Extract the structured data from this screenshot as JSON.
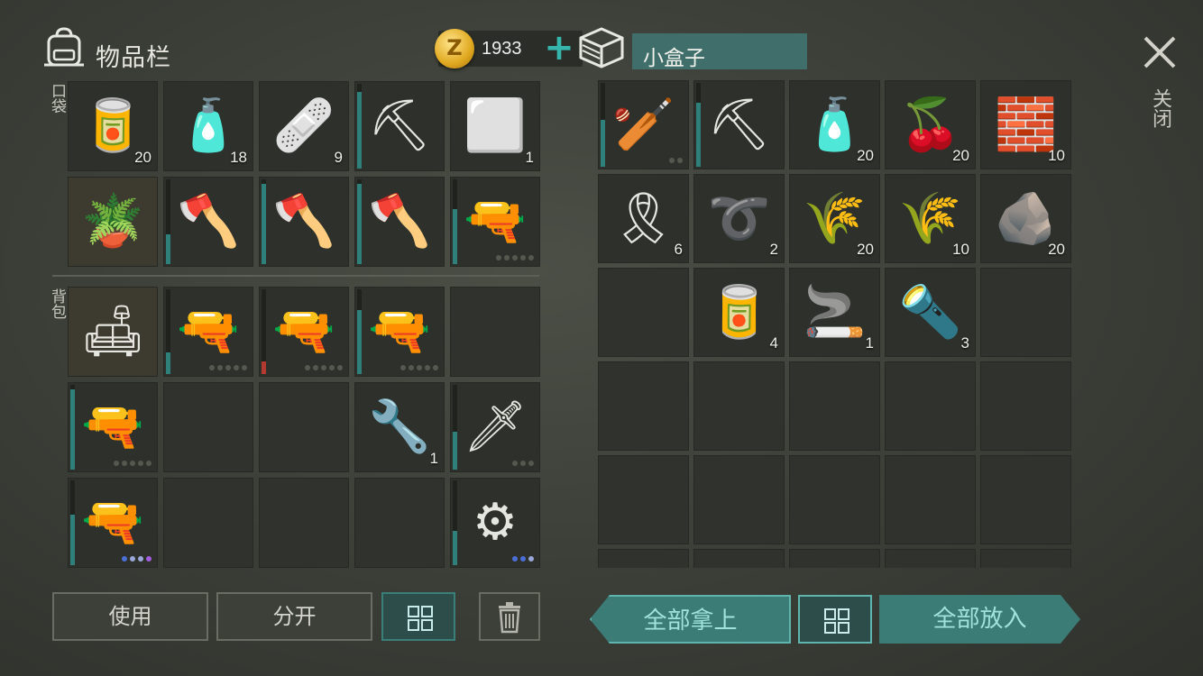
{
  "inventory": {
    "title": "物品栏",
    "coins": "1933",
    "add_symbol": "+",
    "pocket_label": "口袋",
    "backpack_label": "背包",
    "pocket": [
      {
        "icon": "canned-food-icon",
        "glyph": "🥫",
        "qty": "20"
      },
      {
        "icon": "water-bottle-icon",
        "glyph": "🧴",
        "qty": "18"
      },
      {
        "icon": "bandage-icon",
        "glyph": "🩹",
        "qty": "9"
      },
      {
        "icon": "shovel-icon",
        "glyph": "⛏",
        "qty": "",
        "dur": 0.9
      },
      {
        "icon": "metal-plate-icon",
        "glyph": "⬜",
        "qty": "1"
      },
      {
        "icon": "potted-plant-icon",
        "glyph": "🪴",
        "qty": "",
        "highlight": true
      },
      {
        "icon": "hatchet-icon",
        "glyph": "🪓",
        "qty": "",
        "dur": 0.35
      },
      {
        "icon": "hatchet-icon",
        "glyph": "🪓",
        "qty": "",
        "dur": 0.95
      },
      {
        "icon": "hatchet-icon",
        "glyph": "🪓",
        "qty": "",
        "dur": 0.95
      },
      {
        "icon": "pistol-icon",
        "glyph": "🔫",
        "qty": "",
        "dur": 0.65,
        "dots": [
          "",
          "",
          "",
          "",
          ""
        ]
      }
    ],
    "backpack": [
      {
        "icon": "sofa-icon",
        "glyph": "🛋",
        "qty": "",
        "highlight": true
      },
      {
        "icon": "pistol-icon",
        "glyph": "🔫",
        "qty": "",
        "dur": 0.25,
        "dots": [
          "",
          "",
          "",
          "",
          ""
        ]
      },
      {
        "icon": "pistol-icon",
        "glyph": "🔫",
        "qty": "",
        "dur": 0.15,
        "dur_color": "#b33a2e",
        "dots": [
          "",
          "",
          "",
          "",
          ""
        ]
      },
      {
        "icon": "pistol-icon",
        "glyph": "🔫",
        "qty": "",
        "dur": 0.75,
        "dots": [
          "",
          "",
          "",
          "",
          ""
        ]
      },
      {
        "icon": "",
        "glyph": "",
        "qty": ""
      },
      {
        "icon": "pistol-icon",
        "glyph": "🔫",
        "qty": "",
        "dur": 0.95,
        "dots": [
          "",
          "",
          "",
          "",
          ""
        ]
      },
      {
        "icon": "",
        "glyph": "",
        "qty": ""
      },
      {
        "icon": "",
        "glyph": "",
        "qty": ""
      },
      {
        "icon": "wrench-icon",
        "glyph": "🔧",
        "qty": "1"
      },
      {
        "icon": "machete-icon",
        "glyph": "🗡",
        "qty": "",
        "dur": 0.45,
        "dots": [
          "",
          "",
          ""
        ]
      },
      {
        "icon": "assault-rifle-icon",
        "glyph": "🔫",
        "qty": "",
        "dur": 0.6,
        "dots": [
          "blue",
          "light",
          "light",
          "purple"
        ]
      },
      {
        "icon": "",
        "glyph": "",
        "qty": ""
      },
      {
        "icon": "",
        "glyph": "",
        "qty": ""
      },
      {
        "icon": "",
        "glyph": "",
        "qty": ""
      },
      {
        "icon": "saw-mace-icon",
        "glyph": "⚙",
        "qty": "",
        "dur": 0.4,
        "dots": [
          "blue",
          "blue",
          "light"
        ]
      }
    ]
  },
  "box": {
    "name": "小盒子",
    "items": [
      {
        "icon": "baseball-bat-icon",
        "glyph": "🏏",
        "qty": "",
        "dur": 0.55,
        "dots": [
          "",
          ""
        ]
      },
      {
        "icon": "pickaxe-icon",
        "glyph": "⛏",
        "qty": "",
        "dur": 0.75
      },
      {
        "icon": "water-bottle-icon",
        "glyph": "🧴",
        "qty": "20"
      },
      {
        "icon": "berries-icon",
        "glyph": "🍒",
        "qty": "20"
      },
      {
        "icon": "iron-ingot-icon",
        "glyph": "🧱",
        "qty": "10"
      },
      {
        "icon": "duct-tape-icon",
        "glyph": "🎗",
        "qty": "6"
      },
      {
        "icon": "wire-coil-icon",
        "glyph": "➰",
        "qty": "2"
      },
      {
        "icon": "plant-fiber-icon",
        "glyph": "🌾",
        "qty": "20"
      },
      {
        "icon": "plant-fiber-icon",
        "glyph": "🌾",
        "qty": "10"
      },
      {
        "icon": "stone-icon",
        "glyph": "🪨",
        "qty": "20"
      },
      {
        "icon": "",
        "glyph": "",
        "qty": ""
      },
      {
        "icon": "open-can-icon",
        "glyph": "🥫",
        "qty": "4"
      },
      {
        "icon": "cigarettes-icon",
        "glyph": "🚬",
        "qty": "1"
      },
      {
        "icon": "flashlight-icon",
        "glyph": "🔦",
        "qty": "3"
      },
      {
        "icon": "",
        "glyph": "",
        "qty": ""
      },
      {
        "icon": "",
        "glyph": "",
        "qty": ""
      },
      {
        "icon": "",
        "glyph": "",
        "qty": ""
      },
      {
        "icon": "",
        "glyph": "",
        "qty": ""
      },
      {
        "icon": "",
        "glyph": "",
        "qty": ""
      },
      {
        "icon": "",
        "glyph": "",
        "qty": ""
      },
      {
        "icon": "",
        "glyph": "",
        "qty": ""
      },
      {
        "icon": "",
        "glyph": "",
        "qty": ""
      },
      {
        "icon": "",
        "glyph": "",
        "qty": ""
      },
      {
        "icon": "",
        "glyph": "",
        "qty": ""
      },
      {
        "icon": "",
        "glyph": "",
        "qty": ""
      },
      {
        "icon": "",
        "glyph": "",
        "qty": ""
      },
      {
        "icon": "",
        "glyph": "",
        "qty": ""
      },
      {
        "icon": "",
        "glyph": "",
        "qty": ""
      },
      {
        "icon": "",
        "glyph": "",
        "qty": ""
      },
      {
        "icon": "",
        "glyph": "",
        "qty": ""
      }
    ]
  },
  "close_label": "关闭",
  "buttons": {
    "use": "使用",
    "split": "分开",
    "take_all": "全部拿上",
    "put_all": "全部放入"
  },
  "colors": {
    "accent_teal": "#3c7c77",
    "durability": "#2f7f7a",
    "coin": "#e0a81f"
  }
}
